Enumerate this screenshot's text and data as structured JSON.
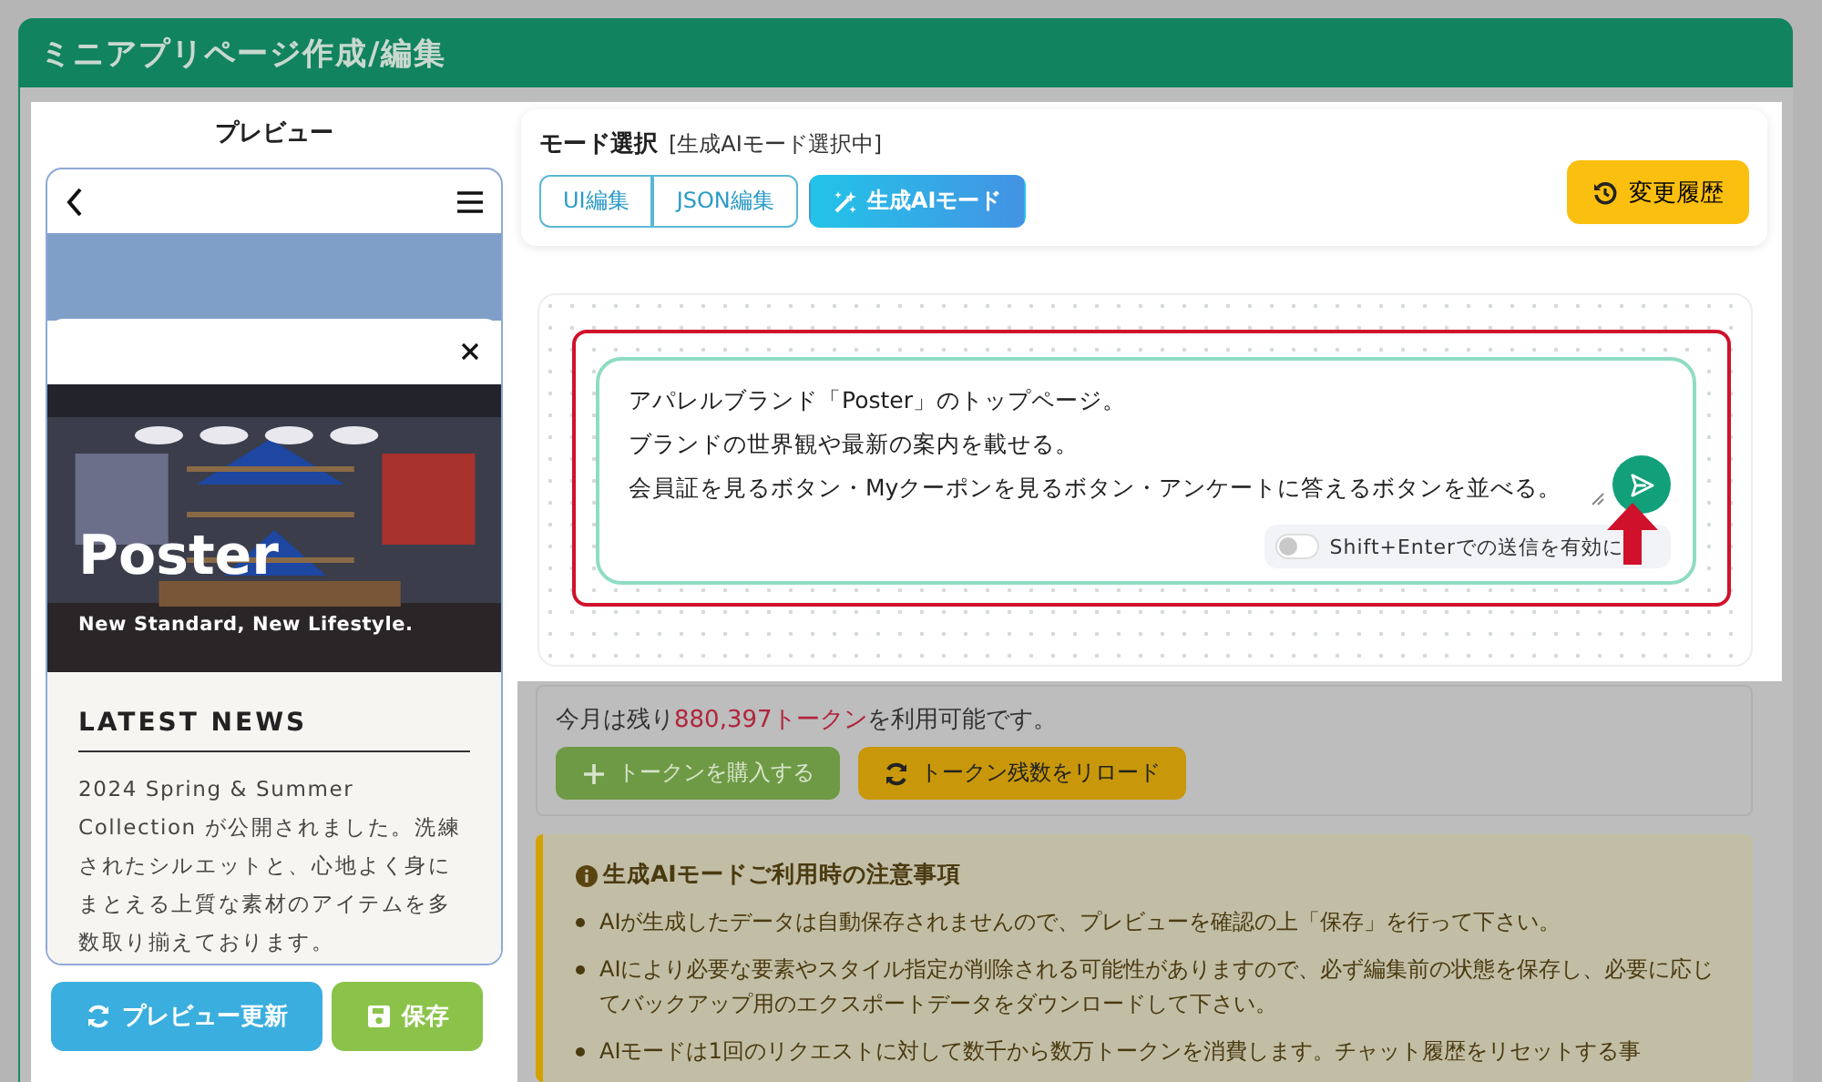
{
  "window": {
    "title": "ミニアプリページ作成/編集"
  },
  "preview": {
    "heading": "プレビュー",
    "phone": {
      "hero": {
        "kind": "picture",
        "title": "Poster",
        "tagline": "New Standard, New Lifestyle."
      },
      "news": {
        "heading": "LATEST NEWS",
        "body": "2024 Spring & Summer Collection が公開されました。洗練されたシルエットと、心地よく身にまとえる上質な素材のアイテムを多数取り揃えております。"
      }
    },
    "buttons": [
      {
        "label": "プレビュー更新",
        "kind": "refresh"
      },
      {
        "label": "保存",
        "kind": "save"
      }
    ]
  },
  "mode": {
    "title": "モード選択",
    "status": "[生成AIモード選択中]",
    "modes": [
      {
        "label": "UI編集",
        "selected": false,
        "kind": "plain"
      },
      {
        "label": "JSON編集",
        "selected": false,
        "kind": "plain"
      },
      {
        "label": "生成AIモード",
        "selected": true,
        "kind": "ai"
      }
    ],
    "history_button": "変更履歴"
  },
  "prompt": {
    "lines": [
      "アパレルブランド「Poster」のトップページ。",
      "ブランドの世界観や最新の案内を載せる。",
      "会員証を見るボタン・Myクーポンを見るボタン・アンケートに答えるボタンを並べる。"
    ],
    "toggle": {
      "label": "Shift+Enterでの送信を有効に",
      "on": false
    }
  },
  "tokens": {
    "message": "今月は残り**880,397トークン**を利用可能です。",
    "buttons": [
      {
        "label": "トークンを購入する",
        "kind": "buy"
      },
      {
        "label": "トークン残数をリロード",
        "kind": "reload"
      }
    ]
  },
  "notice": {
    "title": "生成AIモードご利用時の注意事項",
    "items": [
      "AIが生成したデータは自動保存されませんので、プレビューを確認の上「保存」を行って下さい。",
      "AIにより必要な要素やスタイル指定が削除される可能性がありますので、必ず編集前の状態を保存し、必要に応じてバックアップ用のエクスポートデータをダウンロードして下さい。",
      "AIモードは1回のリクエストに対して数千から数万トークンを消費します。チャット履歴をリセットする事"
    ]
  }
}
